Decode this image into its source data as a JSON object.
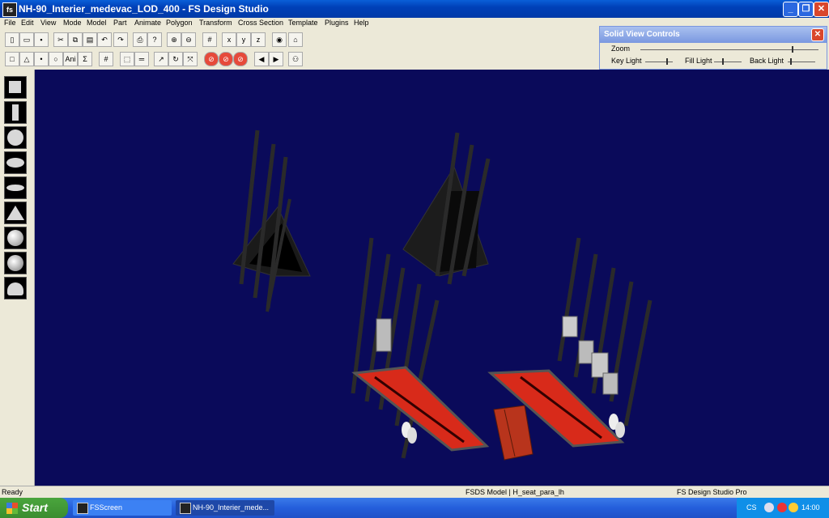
{
  "window": {
    "title": "NH-90_Interier_medevac_LOD_400 - FS Design Studio",
    "icon_label": "fs"
  },
  "menu": [
    "File",
    "Edit",
    "View",
    "Mode",
    "Model",
    "Part",
    "Animate",
    "Polygon",
    "Transform",
    "Cross Section",
    "Template",
    "Plugins",
    "Help"
  ],
  "toolbar": {
    "ani_label": "Ani"
  },
  "solid_view_controls": {
    "title": "Solid View Controls",
    "zoom_label": "Zoom",
    "zoom_value": 0.85,
    "key_light_label": "Key Light",
    "key_light_value": 0.75,
    "fill_light_label": "Fill Light",
    "fill_light_value": 0.3,
    "back_light_label": "Back Light",
    "back_light_value": 0.1
  },
  "status": {
    "left": "Ready",
    "middle": "FSDS Model | H_seat_para_lh",
    "right": "FS Design Studio Pro"
  },
  "taskbar": {
    "start_label": "Start",
    "tasks": [
      {
        "label": "FSScreen"
      },
      {
        "label": "NH-90_Interier_mede..."
      }
    ],
    "tray_lang": "CS",
    "tray_time": "14:00"
  },
  "colors": {
    "viewport_bg": "#0a0a5a",
    "stretcher_red": "#d82a1a",
    "frame": "#2a2a2a"
  }
}
